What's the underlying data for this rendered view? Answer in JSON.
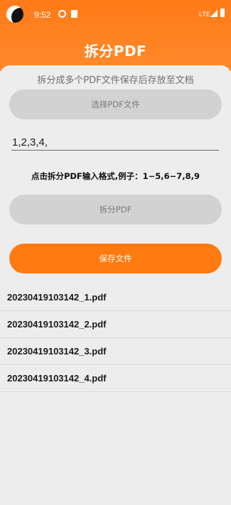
{
  "status_bar": {
    "time": "9:52",
    "network": "LTE"
  },
  "app": {
    "title": "拆分PDF"
  },
  "main": {
    "subtitle": "拆分成多个PDF文件保存后存放至文档",
    "select_button": "选择PDF文件",
    "page_input_value": "1,2,3,4,",
    "hint": "点击拆分PDF输入格式,例子：1−5,6−7,8,9",
    "split_button": "拆分PDF",
    "save_button": "保存文件",
    "files": [
      "20230419103142_1.pdf",
      "20230419103142_2.pdf",
      "20230419103142_3.pdf",
      "20230419103142_4.pdf"
    ]
  },
  "colors": {
    "accent": "#ff7a10",
    "disabled_button": "#d2d2d2",
    "background": "#ececec"
  }
}
